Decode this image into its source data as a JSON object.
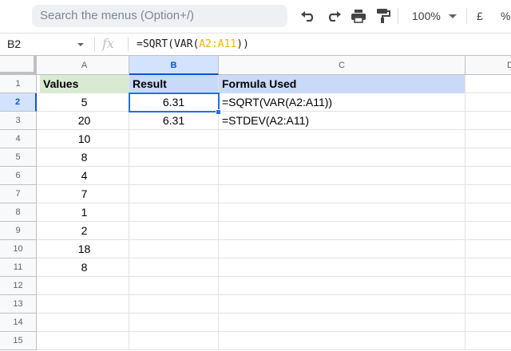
{
  "toolbar": {
    "search_placeholder": "Search the menus (Option+/)",
    "zoom": "100%",
    "currency_symbol": "£",
    "percent_symbol": "%"
  },
  "formula_bar": {
    "name_box": "B2",
    "fx_label": "fx",
    "formula_prefix": "=SQRT(VAR(",
    "formula_ref": "A2:A11",
    "formula_suffix": "))"
  },
  "columns": [
    "A",
    "B",
    "C",
    "D"
  ],
  "row_numbers": [
    "1",
    "2",
    "3",
    "4",
    "5",
    "6",
    "7",
    "8",
    "9",
    "10",
    "11",
    "12",
    "13",
    "14",
    "15"
  ],
  "active_cell": {
    "column": "B",
    "row": "2"
  },
  "header_row": {
    "a": "Values",
    "b": "Result",
    "c": "Formula Used"
  },
  "values": [
    "5",
    "20",
    "10",
    "8",
    "4",
    "7",
    "1",
    "2",
    "18",
    "8"
  ],
  "results": [
    {
      "value": "6.31",
      "formula": "=SQRT(VAR(A2:A11))"
    },
    {
      "value": "6.31",
      "formula": "=STDEV(A2:A11)"
    }
  ],
  "colors": {
    "header_green": "#d9ead3",
    "header_blue": "#c9daf8",
    "selection": "#1a73e8",
    "formula_range": "#f4b400"
  }
}
